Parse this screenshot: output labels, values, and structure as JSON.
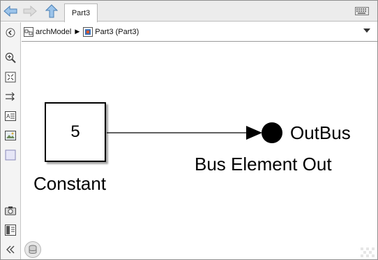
{
  "nav": {
    "back_icon": "back-arrow-icon",
    "forward_icon": "forward-arrow-icon",
    "up_icon": "up-arrow-icon"
  },
  "tabs": [
    {
      "label": "Part3"
    }
  ],
  "breadcrumb": {
    "items": [
      {
        "label": "archModel",
        "icon": "model-icon"
      },
      {
        "label": "Part3 (Part3)",
        "icon": "subsystem-icon"
      }
    ]
  },
  "canvas": {
    "constant_block": {
      "value": "5",
      "label": "Constant"
    },
    "outport_block": {
      "signal_name": "OutBus",
      "label": "Bus Element Out"
    }
  },
  "toolbar": {
    "items": [
      "navigate-back-icon",
      "zoom-in-icon",
      "fit-to-view-icon",
      "arrows-icon",
      "annotation-icon",
      "image-icon",
      "area-icon",
      "screenshot-icon",
      "explorer-bar-icon",
      "collapse-icon"
    ]
  }
}
